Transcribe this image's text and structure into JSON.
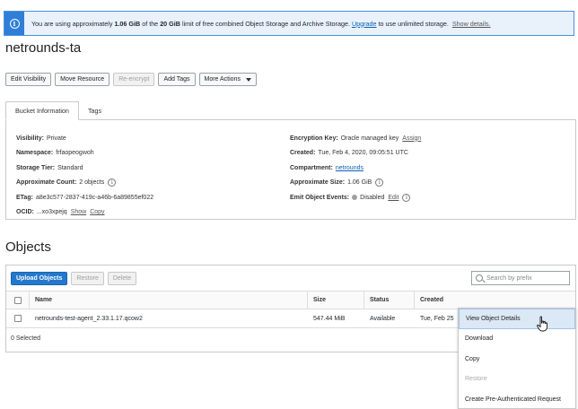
{
  "banner": {
    "icon": "info-icon",
    "text_before": "You are using approximately ",
    "usage": "1.06 GiB",
    "text_middle": " of the ",
    "limit": "20 GiB",
    "text_after": " limit of free combined Object Storage and Archive Storage. ",
    "upgrade_link": "Upgrade",
    "text_tail": " to use unlimited storage.",
    "details_link": "Show details."
  },
  "page_title": "netrounds-ta",
  "toolbar": {
    "edit_visibility": "Edit Visibility",
    "move_resource": "Move Resource",
    "re_encrypt": "Re-encrypt",
    "add_tags": "Add Tags",
    "more_actions": "More Actions"
  },
  "tabs": {
    "bucket_info": "Bucket Information",
    "tags": "Tags"
  },
  "bucket_info": {
    "left": {
      "visibility_key": "Visibility:",
      "visibility_val": "Private",
      "namespace_key": "Namespace:",
      "namespace_val": "frfaopeogwoh",
      "tier_key": "Storage Tier:",
      "tier_val": "Standard",
      "count_key": "Approximate Count:",
      "count_val": "2 objects",
      "etag_key": "ETag:",
      "etag_val": "a8e3c577-2837-419c-a46b-6a89855ef022",
      "ocid_key": "OCID:",
      "ocid_val": "...xo3xpejq",
      "ocid_show": "Show",
      "ocid_copy": "Copy"
    },
    "right": {
      "enc_key": "Encryption Key:",
      "enc_val": "Oracle managed key",
      "enc_assign": "Assign",
      "created_key": "Created:",
      "created_val": "Tue, Feb 4, 2020, 09:05:51 UTC",
      "compartment_key": "Compartment:",
      "compartment_val": "netrounds",
      "size_key": "Approximate Size:",
      "size_val": "1.06 GiB",
      "events_key": "Emit Object Events:",
      "events_val": "Disabled",
      "events_edit": "Edit"
    }
  },
  "objects": {
    "title": "Objects",
    "upload": "Upload Objects",
    "restore": "Restore",
    "delete": "Delete",
    "search_placeholder": "Search by prefix",
    "columns": {
      "name": "Name",
      "size": "Size",
      "status": "Status",
      "created": "Created"
    },
    "rows": [
      {
        "name": "netrounds-test-agent_2.33.1.17.qcow2",
        "size": "547.44 MiB",
        "status": "Available",
        "created": "Tue, Feb 25"
      }
    ],
    "selected": "0 Selected"
  },
  "context_menu": {
    "items": [
      {
        "label": "View Object Details",
        "state": "hover"
      },
      {
        "label": "Download",
        "state": "normal"
      },
      {
        "label": "Copy",
        "state": "normal"
      },
      {
        "label": "Restore",
        "state": "disabled"
      },
      {
        "label": "Create Pre-Authenticated Request",
        "state": "normal"
      }
    ]
  },
  "colors": {
    "primary": "#2478cc",
    "link": "#0a5fb4",
    "banner_bg": "#e9f2fb",
    "menu_hover": "#dbe8f6"
  }
}
